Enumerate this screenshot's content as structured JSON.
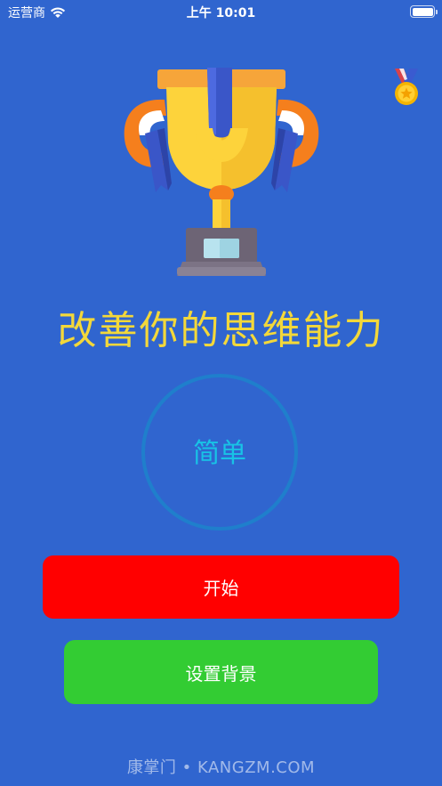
{
  "status_bar": {
    "carrier": "运营商",
    "time": "上午 10:01"
  },
  "icons": {
    "wifi": "wifi-icon",
    "battery": "battery-icon",
    "trophy": "trophy-icon",
    "medal": "medal-icon"
  },
  "main": {
    "headline": "改善你的思维能力",
    "difficulty": "简单",
    "start_label": "开始",
    "set_background_label": "设置背景"
  },
  "watermark": "康掌门 • KANGZM.COM",
  "colors": {
    "background": "#3065cf",
    "headline": "#f3d83a",
    "difficulty_text": "#18c3e6",
    "difficulty_ring": "#1f7fcc",
    "start_button": "#ff0000",
    "background_button": "#33cc33"
  }
}
